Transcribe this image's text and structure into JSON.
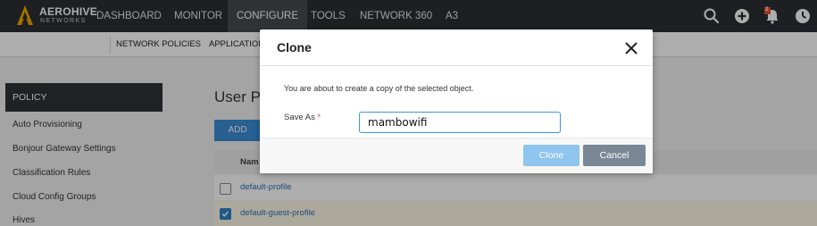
{
  "brand": {
    "name": "AEROHIVE",
    "sub": "NETWORKS"
  },
  "nav": {
    "items": [
      "DASHBOARD",
      "MONITOR",
      "CONFIGURE",
      "TOOLS",
      "NETWORK 360",
      "A3"
    ],
    "active": "CONFIGURE",
    "icons": [
      "search-icon",
      "add-icon",
      "notifications-icon",
      "clock-icon"
    ],
    "notification_count": "2"
  },
  "subnav": {
    "items": [
      "NETWORK POLICIES",
      "APPLICATION"
    ]
  },
  "sidebar": {
    "header": "POLICY",
    "items": [
      "Auto Provisioning",
      "Bonjour Gateway Settings",
      "Classification Rules",
      "Cloud Config Groups",
      "Hives"
    ]
  },
  "main": {
    "title": "User P",
    "add_label": "ADD",
    "column_name": "Nam",
    "rows": [
      {
        "name": "default-profile",
        "checked": false
      },
      {
        "name": "default-guest-profile",
        "checked": true
      }
    ]
  },
  "modal": {
    "title": "Clone",
    "message": "You are about to create a copy of the selected object.",
    "save_as_label": "Save As",
    "required_mark": "*",
    "save_as_value": "mambowifi",
    "clone_label": "Clone",
    "cancel_label": "Cancel"
  },
  "colors": {
    "nav_bg": "#2b2f33",
    "accent": "#3a8ed6",
    "clone_button": "#8ec5ee",
    "cancel_button": "#7a8794",
    "logo": "#f0a500"
  }
}
